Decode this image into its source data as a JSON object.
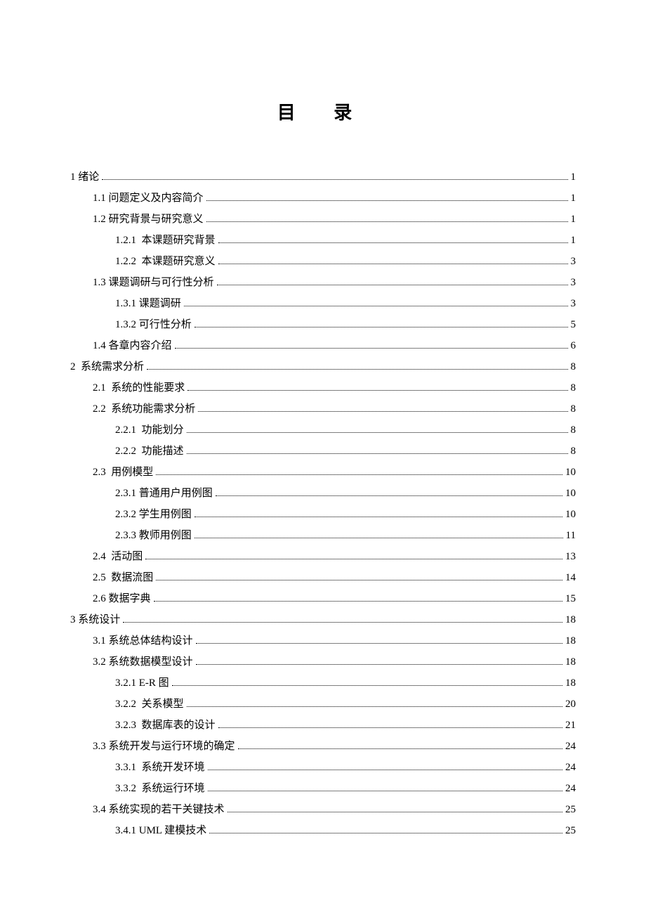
{
  "title": "目 录",
  "toc": [
    {
      "level": 0,
      "label": "1 绪论",
      "page": "1"
    },
    {
      "level": 1,
      "label": "1.1 问题定义及内容简介",
      "page": "1"
    },
    {
      "level": 1,
      "label": "1.2 研究背景与研究意义",
      "page": "1"
    },
    {
      "level": 2,
      "label": "1.2.1  本课题研究背景",
      "page": "1"
    },
    {
      "level": 2,
      "label": "1.2.2  本课题研究意义",
      "page": "3"
    },
    {
      "level": 1,
      "label": "1.3 课题调研与可行性分析",
      "page": "3"
    },
    {
      "level": 2,
      "label": "1.3.1 课题调研",
      "page": "3"
    },
    {
      "level": 2,
      "label": "1.3.2 可行性分析",
      "page": "5"
    },
    {
      "level": 1,
      "label": "1.4 各章内容介绍",
      "page": "6"
    },
    {
      "level": 0,
      "label": "2  系统需求分析",
      "page": "8"
    },
    {
      "level": 1,
      "label": "2.1  系统的性能要求",
      "page": "8"
    },
    {
      "level": 1,
      "label": "2.2  系统功能需求分析",
      "page": "8"
    },
    {
      "level": 2,
      "label": "2.2.1  功能划分",
      "page": "8"
    },
    {
      "level": 2,
      "label": "2.2.2  功能描述",
      "page": "8"
    },
    {
      "level": 1,
      "label": "2.3  用例模型",
      "page": "10"
    },
    {
      "level": 2,
      "label": "2.3.1 普通用户用例图",
      "page": "10"
    },
    {
      "level": 2,
      "label": "2.3.2 学生用例图",
      "page": "10"
    },
    {
      "level": 2,
      "label": "2.3.3 教师用例图",
      "page": "11"
    },
    {
      "level": 1,
      "label": "2.4  活动图",
      "page": "13"
    },
    {
      "level": 1,
      "label": "2.5  数据流图",
      "page": "14"
    },
    {
      "level": 1,
      "label": "2.6 数据字典",
      "page": "15"
    },
    {
      "level": 0,
      "label": "3 系统设计",
      "page": "18"
    },
    {
      "level": 1,
      "label": "3.1 系统总体结构设计",
      "page": "18"
    },
    {
      "level": 1,
      "label": "3.2 系统数据模型设计",
      "page": "18"
    },
    {
      "level": 2,
      "label": "3.2.1 E-R 图",
      "page": "18"
    },
    {
      "level": 2,
      "label": "3.2.2  关系模型",
      "page": "20"
    },
    {
      "level": 2,
      "label": "3.2.3  数据库表的设计",
      "page": "21"
    },
    {
      "level": 1,
      "label": "3.3 系统开发与运行环境的确定",
      "page": "24"
    },
    {
      "level": 2,
      "label": "3.3.1  系统开发环境",
      "page": "24"
    },
    {
      "level": 2,
      "label": "3.3.2  系统运行环境",
      "page": "24"
    },
    {
      "level": 1,
      "label": "3.4 系统实现的若干关键技术",
      "page": "25"
    },
    {
      "level": 2,
      "label": "3.4.1 UML 建模技术",
      "page": "25"
    }
  ]
}
